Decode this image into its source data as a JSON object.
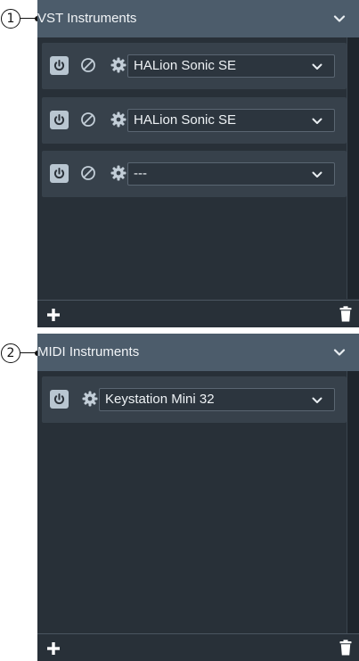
{
  "callouts": [
    {
      "number": "1"
    },
    {
      "number": "2"
    }
  ],
  "sections": [
    {
      "title": "VST Instruments",
      "rows": [
        {
          "value": "HALion Sonic SE"
        },
        {
          "value": "HALion Sonic SE"
        },
        {
          "value": "---"
        }
      ]
    },
    {
      "title": "MIDI Instruments",
      "rows": [
        {
          "value": "Keystation Mini 32"
        }
      ]
    }
  ],
  "icons": {
    "power": "power-icon",
    "edit": "edit-icon",
    "settings": "gear-icon",
    "expand": "chevron-down-icon",
    "dropdown": "chevron-down-icon",
    "add": "plus-icon",
    "remove": "trash-icon"
  },
  "colors": {
    "header": "#4c5c6b",
    "panel": "#2b323a",
    "row": "#37414b",
    "power_button": "#b9c6d1"
  }
}
